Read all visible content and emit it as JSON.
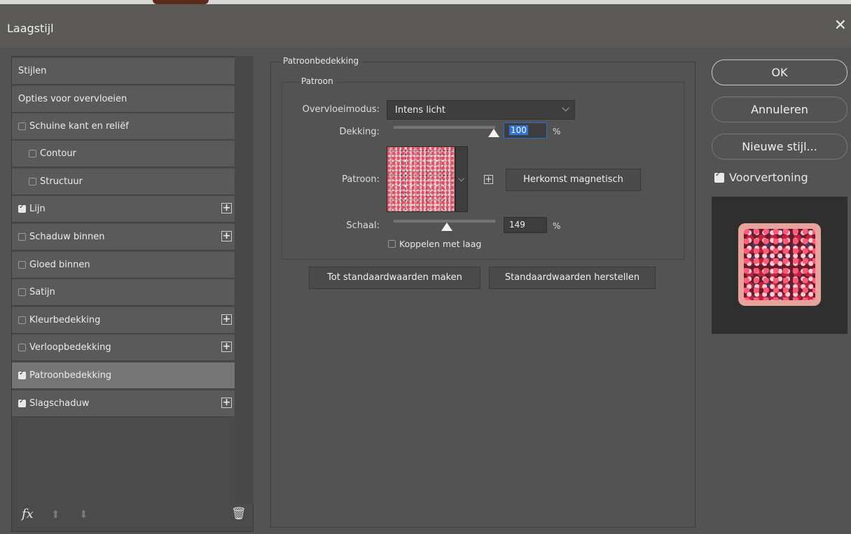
{
  "window": {
    "title": "Laagstijl",
    "close_icon": "close-icon"
  },
  "styles_list": [
    {
      "label": "Stijlen",
      "checkbox": false,
      "checked": false,
      "add": false,
      "indent": false
    },
    {
      "label": "Opties voor overvloeien",
      "checkbox": false,
      "checked": false,
      "add": false,
      "indent": false
    },
    {
      "label": "Schuine kant en reliëf",
      "checkbox": true,
      "checked": false,
      "add": false,
      "indent": false
    },
    {
      "label": "Contour",
      "checkbox": true,
      "checked": false,
      "add": false,
      "indent": true
    },
    {
      "label": "Structuur",
      "checkbox": true,
      "checked": false,
      "add": false,
      "indent": true
    },
    {
      "label": "Lijn",
      "checkbox": true,
      "checked": true,
      "add": true,
      "indent": false
    },
    {
      "label": "Schaduw binnen",
      "checkbox": true,
      "checked": false,
      "add": true,
      "indent": false
    },
    {
      "label": "Gloed binnen",
      "checkbox": true,
      "checked": false,
      "add": false,
      "indent": false
    },
    {
      "label": "Satijn",
      "checkbox": true,
      "checked": false,
      "add": false,
      "indent": false
    },
    {
      "label": "Kleurbedekking",
      "checkbox": true,
      "checked": false,
      "add": true,
      "indent": false
    },
    {
      "label": "Verloopbedekking",
      "checkbox": true,
      "checked": false,
      "add": true,
      "indent": false
    },
    {
      "label": "Patroonbedekking",
      "checkbox": true,
      "checked": true,
      "add": false,
      "indent": false,
      "selected": true
    },
    {
      "label": "Slagschaduw",
      "checkbox": true,
      "checked": true,
      "add": true,
      "indent": false
    }
  ],
  "bottom_bar": {
    "fx_label": "fx",
    "up_icon": "arrow-up-icon",
    "down_icon": "arrow-down-icon",
    "trash_icon": "trash-icon"
  },
  "panel": {
    "section_title": "Patroonbedekking",
    "group_title": "Patroon",
    "blend_mode_label": "Overvloeimodus:",
    "blend_mode_value": "Intens licht",
    "opacity_label": "Dekking:",
    "opacity_value": "100",
    "opacity_unit": "%",
    "opacity_fraction": 1.0,
    "pattern_label": "Patroon:",
    "snap_origin_button": "Herkomst magnetisch",
    "scale_label": "Schaal:",
    "scale_value": "149",
    "scale_unit": "%",
    "link_label": "Koppelen met laag",
    "link_checked": false,
    "make_default_button": "Tot standaardwaarden maken",
    "reset_default_button": "Standaardwaarden herstellen"
  },
  "right": {
    "ok": "OK",
    "cancel": "Annuleren",
    "new_style": "Nieuwe stijl...",
    "preview_label": "Voorvertoning",
    "preview_checked": true
  },
  "colors": {
    "background": "#535353",
    "selected_row": "#757575",
    "focus_blue": "#2f73d8",
    "preview_frame": "#e8a39c"
  }
}
